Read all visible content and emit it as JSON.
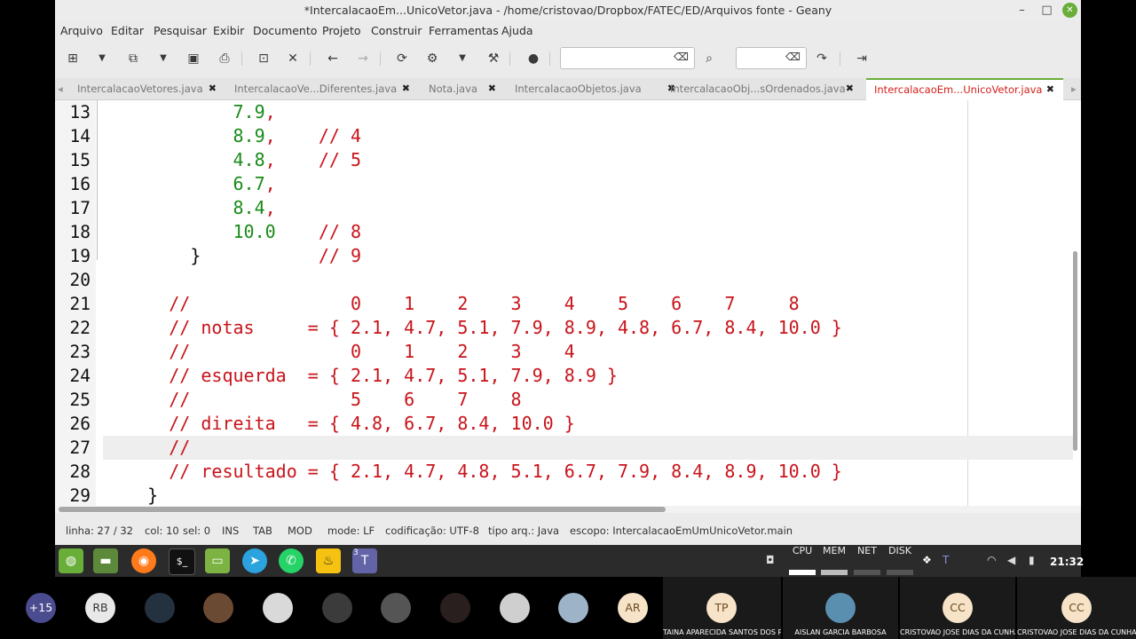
{
  "window": {
    "title": "*IntercalacaoEm...UnicoVetor.java - /home/cristovao/Dropbox/FATEC/ED/Arquivos fonte - Geany"
  },
  "menu": [
    "Arquivo",
    "Editar",
    "Pesquisar",
    "Exibir",
    "Documento",
    "Projeto",
    "Construir",
    "Ferramentas",
    "Ajuda"
  ],
  "toolbar": {
    "icons": [
      "new-file-icon",
      "dropdown-icon",
      "open-file-icon",
      "dropdown-icon",
      "save-icon",
      "save-all-icon",
      "revert-icon",
      "close-file-icon",
      "back-icon",
      "forward-icon",
      "compile-icon",
      "build-icon",
      "dropdown-icon",
      "run-icon",
      "color-picker-icon",
      "search-icon",
      "jump-icon",
      "quit-icon"
    ],
    "search_value": "",
    "goto_value": ""
  },
  "tabs": [
    {
      "label": "IntercalacaoVetores.java",
      "active": false
    },
    {
      "label": "IntercalacaoVe...Diferentes.java",
      "active": false
    },
    {
      "label": "Nota.java",
      "active": false
    },
    {
      "label": "IntercalacaoObjetos.java",
      "active": false
    },
    {
      "label": "IntercalacaoObj...sOrdenados.java",
      "active": false
    },
    {
      "label": "IntercalacaoEm...UnicoVetor.java",
      "active": true
    }
  ],
  "editor": {
    "current_line": 27,
    "lines": [
      {
        "n": "13",
        "segs": [
          {
            "t": "            ",
            "c": "black"
          },
          {
            "t": "7.9",
            "c": "green"
          },
          {
            "t": ",",
            "c": "red"
          }
        ]
      },
      {
        "n": "14",
        "segs": [
          {
            "t": "            ",
            "c": "black"
          },
          {
            "t": "8.9",
            "c": "green"
          },
          {
            "t": ",    // 4",
            "c": "red"
          }
        ]
      },
      {
        "n": "15",
        "segs": [
          {
            "t": "            ",
            "c": "black"
          },
          {
            "t": "4.8",
            "c": "green"
          },
          {
            "t": ",    // 5",
            "c": "red"
          }
        ]
      },
      {
        "n": "16",
        "segs": [
          {
            "t": "            ",
            "c": "black"
          },
          {
            "t": "6.7",
            "c": "green"
          },
          {
            "t": ",",
            "c": "red"
          }
        ]
      },
      {
        "n": "17",
        "segs": [
          {
            "t": "            ",
            "c": "black"
          },
          {
            "t": "8.4",
            "c": "green"
          },
          {
            "t": ",",
            "c": "red"
          }
        ]
      },
      {
        "n": "18",
        "segs": [
          {
            "t": "            ",
            "c": "black"
          },
          {
            "t": "10.0",
            "c": "green"
          },
          {
            "t": "    // 8",
            "c": "red"
          }
        ]
      },
      {
        "n": "19",
        "segs": [
          {
            "t": "        }",
            "c": "black"
          },
          {
            "t": "           // 9",
            "c": "red"
          }
        ]
      },
      {
        "n": "20",
        "segs": []
      },
      {
        "n": "21",
        "segs": [
          {
            "t": "      //               0    1    2    3    4    5    6    7     8",
            "c": "red"
          }
        ]
      },
      {
        "n": "22",
        "segs": [
          {
            "t": "      // notas     = { 2.1, 4.7, 5.1, 7.9, 8.9, 4.8, 6.7, 8.4, 10.0 }",
            "c": "red"
          }
        ]
      },
      {
        "n": "23",
        "segs": [
          {
            "t": "      //               0    1    2    3    4",
            "c": "red"
          }
        ]
      },
      {
        "n": "24",
        "segs": [
          {
            "t": "      // esquerda  = { 2.1, 4.7, 5.1, 7.9, 8.9 }",
            "c": "red"
          }
        ]
      },
      {
        "n": "25",
        "segs": [
          {
            "t": "      //               5    6    7    8",
            "c": "red"
          }
        ]
      },
      {
        "n": "26",
        "segs": [
          {
            "t": "      // direita   = { 4.8, 6.7, 8.4, 10.0 }",
            "c": "red"
          }
        ]
      },
      {
        "n": "27",
        "segs": [
          {
            "t": "      //",
            "c": "red"
          }
        ]
      },
      {
        "n": "28",
        "segs": [
          {
            "t": "      // resultado = { 2.1, 4.7, 4.8, 5.1, 6.7, 7.9, 8.4, 8.9, 10.0 }",
            "c": "red"
          }
        ]
      },
      {
        "n": "29",
        "segs": [
          {
            "t": "    }",
            "c": "black"
          }
        ]
      }
    ]
  },
  "status": {
    "linha": "linha: 27 / 32",
    "col": "col: 10",
    "sel": "sel: 0",
    "ins": "INS",
    "tab": "TAB",
    "mod": "MOD",
    "mode": "mode: LF",
    "encoding": "codificação: UTF-8",
    "filetype": "tipo arq.: Java",
    "scope": "escopo: IntercalacaoEmUmUnicoVetor.main"
  },
  "taskbar": {
    "apps": [
      "mint-menu-icon",
      "files-icon",
      "firefox-icon",
      "terminal-icon",
      "folder-icon",
      "telegram-icon",
      "whatsapp-icon",
      "geany-icon",
      "teams-icon"
    ],
    "teams_badge": "3",
    "perf": [
      "CPU",
      "MEM",
      "NET",
      "DISK"
    ],
    "clock": "21:32"
  },
  "meeting": {
    "extra_count": "+15",
    "participants": [
      "RB",
      "AR"
    ],
    "tiles": [
      {
        "initials": "TP",
        "name": "TAINA APARECIDA SANTOS DOS PA..."
      },
      {
        "initials": "",
        "name": "AISLAN GARCIA BARBOSA"
      },
      {
        "initials": "CC",
        "name": "CRISTOVAO JOSE DIAS DA CUNHA"
      },
      {
        "initials": "CC",
        "name": "CRISTOVAO JOSE DIAS DA CUNHA"
      }
    ]
  },
  "colors": {
    "comment": "#c8141b",
    "number": "#198b19",
    "active_tab": "#d4201c",
    "accent": "#6aae3a"
  }
}
